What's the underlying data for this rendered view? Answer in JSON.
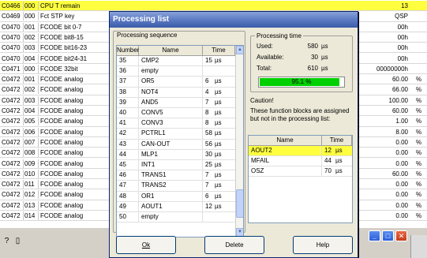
{
  "background_table": {
    "rows": [
      {
        "code": "C0466",
        "sub": "000",
        "name": "CPU T remain",
        "value": "13",
        "unit": "",
        "highlight": true
      },
      {
        "code": "C0469",
        "sub": "000",
        "name": "Fct STP key",
        "value": "QSP",
        "unit": "",
        "highlight": false
      },
      {
        "code": "C0470",
        "sub": "001",
        "name": "FCODE bit 0-7",
        "value": "00h",
        "unit": "",
        "highlight": false
      },
      {
        "code": "C0470",
        "sub": "002",
        "name": "FCODE bit8-15",
        "value": "00h",
        "unit": "",
        "highlight": false
      },
      {
        "code": "C0470",
        "sub": "003",
        "name": "FCODE bit16-23",
        "value": "00h",
        "unit": "",
        "highlight": false
      },
      {
        "code": "C0470",
        "sub": "004",
        "name": "FCODE bit24-31",
        "value": "00h",
        "unit": "",
        "highlight": false
      },
      {
        "code": "C0471",
        "sub": "000",
        "name": "FCODE 32bit",
        "value": "00000000h",
        "unit": "",
        "highlight": false
      },
      {
        "code": "C0472",
        "sub": "001",
        "name": "FCODE analog",
        "value": "60.00",
        "unit": "%",
        "highlight": false
      },
      {
        "code": "C0472",
        "sub": "002",
        "name": "FCODE analog",
        "value": "66.00",
        "unit": "%",
        "highlight": false
      },
      {
        "code": "C0472",
        "sub": "003",
        "name": "FCODE analog",
        "value": "100.00",
        "unit": "%",
        "highlight": false
      },
      {
        "code": "C0472",
        "sub": "004",
        "name": "FCODE analog",
        "value": "60.00",
        "unit": "%",
        "highlight": false
      },
      {
        "code": "C0472",
        "sub": "005",
        "name": "FCODE analog",
        "value": "1.00",
        "unit": "%",
        "highlight": false
      },
      {
        "code": "C0472",
        "sub": "006",
        "name": "FCODE analog",
        "value": "8.00",
        "unit": "%",
        "highlight": false
      },
      {
        "code": "C0472",
        "sub": "007",
        "name": "FCODE analog",
        "value": "0.00",
        "unit": "%",
        "highlight": false
      },
      {
        "code": "C0472",
        "sub": "008",
        "name": "FCODE analog",
        "value": "0.00",
        "unit": "%",
        "highlight": false
      },
      {
        "code": "C0472",
        "sub": "009",
        "name": "FCODE analog",
        "value": "0.00",
        "unit": "%",
        "highlight": false
      },
      {
        "code": "C0472",
        "sub": "010",
        "name": "FCODE analog",
        "value": "60.00",
        "unit": "%",
        "highlight": false
      },
      {
        "code": "C0472",
        "sub": "011",
        "name": "FCODE analog",
        "value": "0.00",
        "unit": "%",
        "highlight": false
      },
      {
        "code": "C0472",
        "sub": "012",
        "name": "FCODE analog",
        "value": "0.00",
        "unit": "%",
        "highlight": false
      },
      {
        "code": "C0472",
        "sub": "013",
        "name": "FCODE analog",
        "value": "0.00",
        "unit": "%",
        "highlight": false
      },
      {
        "code": "C0472",
        "sub": "014",
        "name": "FCODE analog",
        "value": "0.00",
        "unit": "%",
        "highlight": false
      }
    ]
  },
  "dialog": {
    "title": "Processing list",
    "sequence": {
      "label": "Processing sequence",
      "columns": {
        "number": "Number",
        "name": "Name",
        "time": "Time"
      },
      "rows": [
        {
          "number": "35",
          "name": "CMP2",
          "time": "15",
          "unit": "µs"
        },
        {
          "number": "36",
          "name": "empty",
          "time": "",
          "unit": ""
        },
        {
          "number": "37",
          "name": "OR5",
          "time": "6",
          "unit": "µs"
        },
        {
          "number": "38",
          "name": "NOT4",
          "time": "4",
          "unit": "µs"
        },
        {
          "number": "39",
          "name": "AND5",
          "time": "7",
          "unit": "µs"
        },
        {
          "number": "40",
          "name": "CONV5",
          "time": "8",
          "unit": "µs"
        },
        {
          "number": "41",
          "name": "CONV3",
          "time": "8",
          "unit": "µs"
        },
        {
          "number": "42",
          "name": "PCTRL1",
          "time": "58",
          "unit": "µs"
        },
        {
          "number": "43",
          "name": "CAN-OUT",
          "time": "56",
          "unit": "µs"
        },
        {
          "number": "44",
          "name": "MLP1",
          "time": "30",
          "unit": "µs"
        },
        {
          "number": "45",
          "name": "INT1",
          "time": "25",
          "unit": "µs"
        },
        {
          "number": "46",
          "name": "TRANS1",
          "time": "7",
          "unit": "µs"
        },
        {
          "number": "47",
          "name": "TRANS2",
          "time": "7",
          "unit": "µs"
        },
        {
          "number": "48",
          "name": "OR1",
          "time": "6",
          "unit": "µs"
        },
        {
          "number": "49",
          "name": "AOUT1",
          "time": "12",
          "unit": "µs"
        },
        {
          "number": "50",
          "name": "empty",
          "time": "",
          "unit": ""
        }
      ]
    },
    "processing_time": {
      "label": "Processing time",
      "used_label": "Used:",
      "used_value": "580",
      "used_unit": "µs",
      "available_label": "Available:",
      "available_value": "30",
      "available_unit": "µs",
      "total_label": "Total:",
      "total_value": "610",
      "total_unit": "µs",
      "percent_text": "95.1 %",
      "percent": 95.1
    },
    "caution": {
      "title": "Caution!",
      "text": "These function blocks are assigned but not in the processing list:",
      "columns": {
        "name": "Name",
        "time": "Time"
      },
      "rows": [
        {
          "name": "AOUT2",
          "time": "12",
          "unit": "µs",
          "selected": true
        },
        {
          "name": "MFAIL",
          "time": "44",
          "unit": "µs",
          "selected": false
        },
        {
          "name": "OSZ",
          "time": "70",
          "unit": "µs",
          "selected": false
        }
      ]
    },
    "buttons": {
      "ok": "Ok",
      "delete": "Delete",
      "help": "Help"
    }
  },
  "colors": {
    "highlight": "#ffff40",
    "progress": "#00d000",
    "title_bar": "#5c7bc4"
  }
}
